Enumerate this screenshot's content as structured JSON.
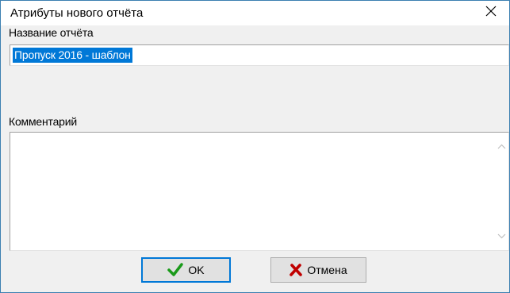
{
  "window": {
    "title": "Атрибуты нового отчёта"
  },
  "form": {
    "name_label": "Название отчёта",
    "name_value": "Пропуск 2016 - шаблон",
    "comment_label": "Комментарий",
    "comment_value": ""
  },
  "buttons": {
    "ok_label": "OK",
    "cancel_label": "Отмена"
  },
  "icons": {
    "ok": "check-icon",
    "cancel": "cross-icon",
    "close": "close-icon"
  },
  "colors": {
    "selection": "#0078d7",
    "check": "#1a9a1a",
    "cross": "#c00000",
    "window_border": "#3c7fb1"
  }
}
